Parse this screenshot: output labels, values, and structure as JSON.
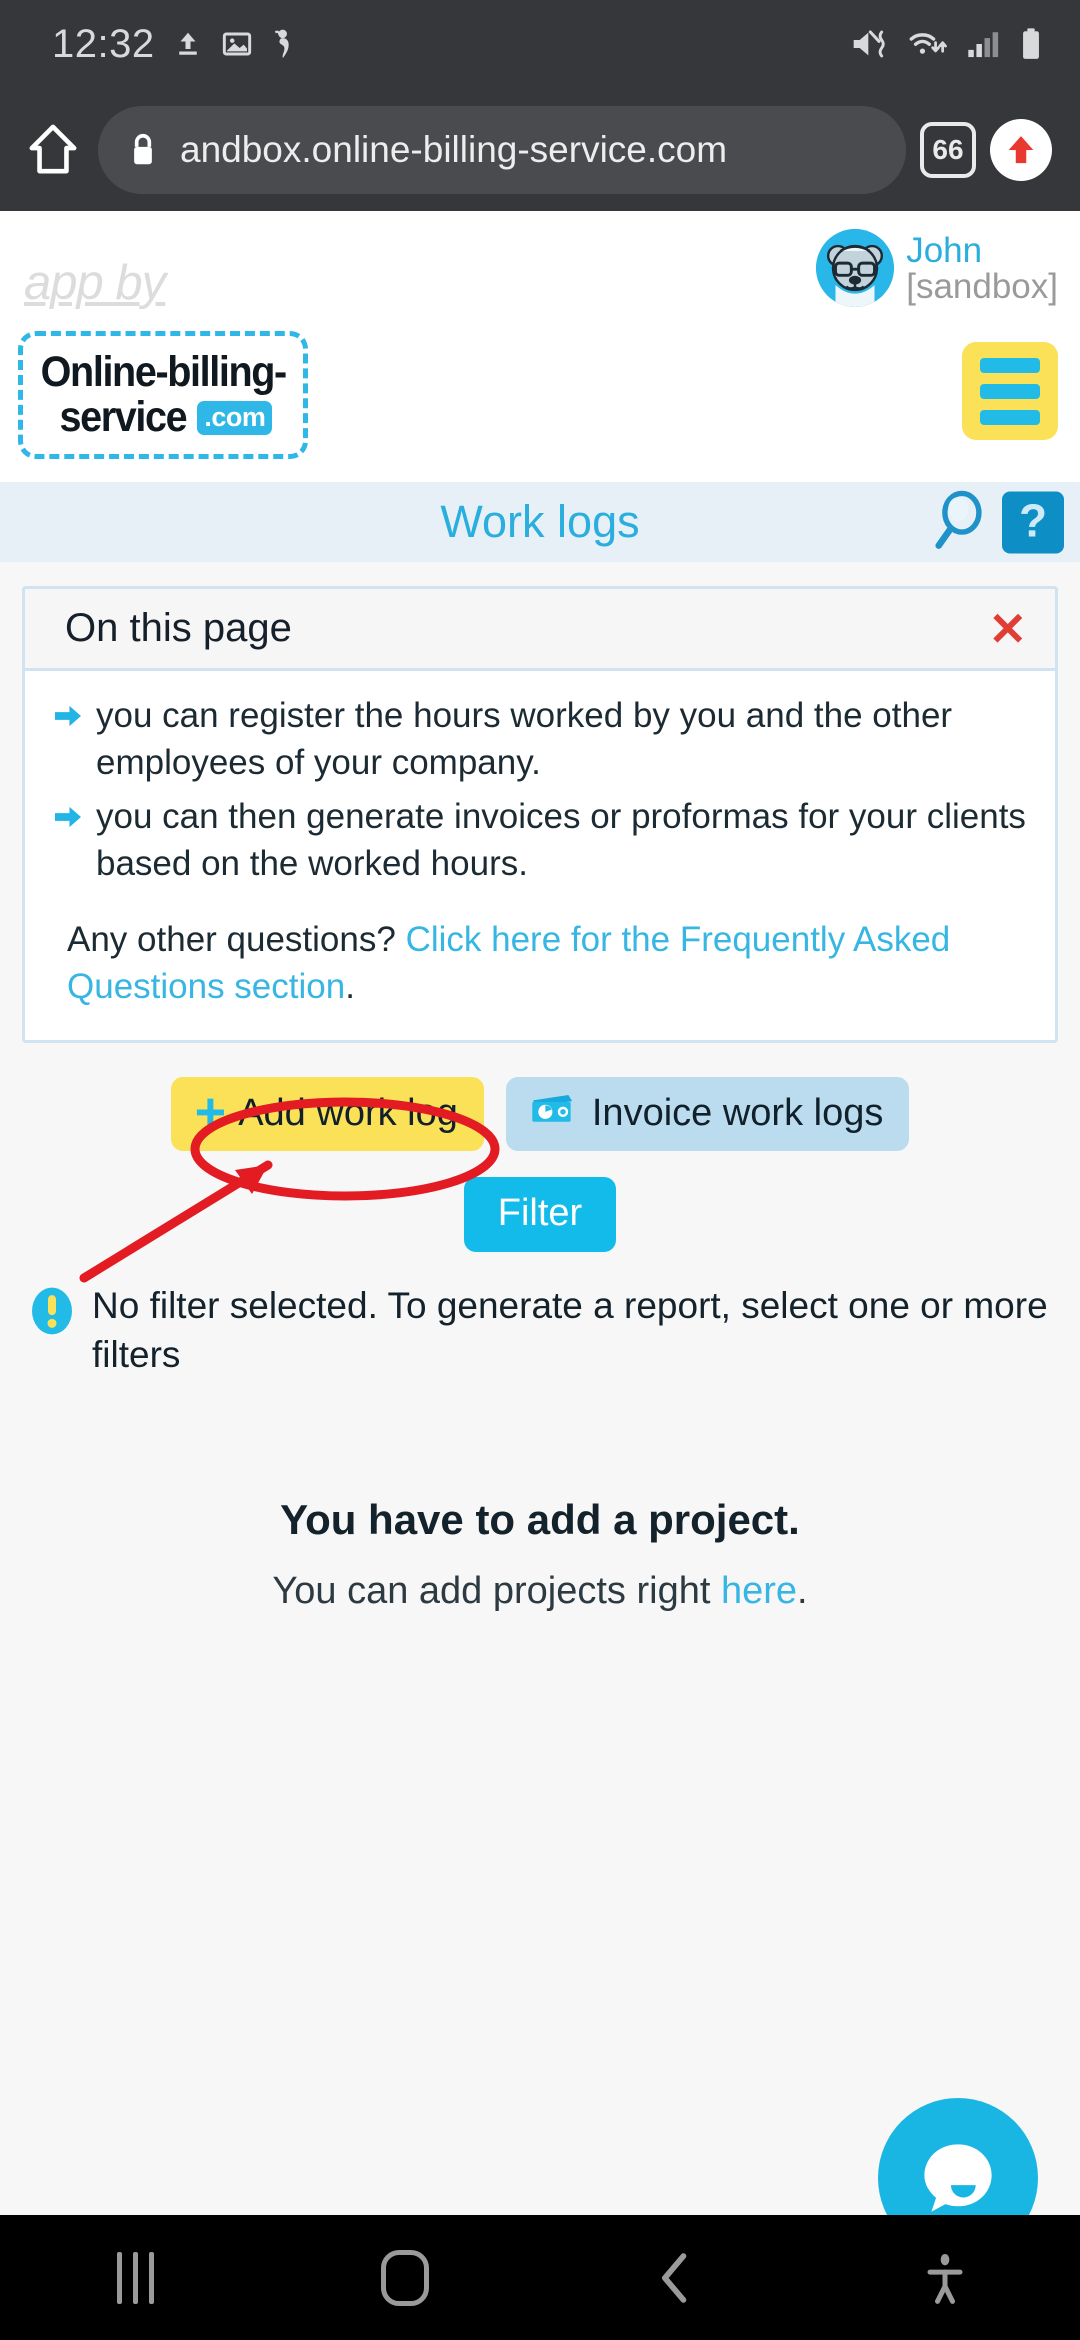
{
  "status_bar": {
    "clock": "12:32",
    "left_icons": [
      "upload-icon",
      "image-icon",
      "scuba-diver-icon"
    ],
    "right_icons": [
      "mute-vibrate-icon",
      "wifi-icon",
      "signal-icon",
      "battery-icon"
    ]
  },
  "browser": {
    "home_icon": "home-icon",
    "lock_icon": "lock-icon",
    "url": "andbox.online-billing-service.com",
    "tab_count": "66",
    "update_icon": "update-arrow-icon"
  },
  "site_header": {
    "app_by": "app by",
    "logo": {
      "line1": "Online-billing-",
      "line2": "service",
      "badge": ".com"
    },
    "user": {
      "name": "John",
      "environment": "[sandbox]"
    },
    "menu_icon": "hamburger-menu-icon"
  },
  "title_bar": {
    "title": "Work logs",
    "search_icon": "search-icon",
    "help_label": "?"
  },
  "info_panel": {
    "heading": "On this page",
    "close_label": "✕",
    "bullets": [
      "you can register the hours worked by you and the other employees of your company.",
      "you can then generate invoices or proformas for your clients based on the worked hours."
    ],
    "faq_prefix": "Any other questions? ",
    "faq_link": "Click here for the Frequently Asked Questions section",
    "faq_suffix": "."
  },
  "actions": {
    "add_work_log": "Add work log",
    "add_icon": "plus-icon",
    "invoice_work_logs": "Invoice work logs",
    "invoice_icon": "banknote-icon",
    "filter": "Filter"
  },
  "notice": {
    "icon": "warning-exclamation-icon",
    "text": "No filter selected. To generate a report, select one or more filters"
  },
  "empty_state": {
    "title": "You have to add a project.",
    "sub_prefix": "You can add projects right ",
    "sub_link": "here",
    "sub_suffix": "."
  },
  "chat": {
    "icon": "chat-bubble-icon"
  },
  "nav_bar": {
    "recents": "recents-icon",
    "home": "home-circle-icon",
    "back": "back-chevron-icon",
    "accessibility": "accessibility-icon"
  },
  "annotations": {
    "highlight_color": "#e31b23",
    "ellipse_target": "add-work-log-button",
    "arrow": "pointer-arrow"
  },
  "colors": {
    "accent_cyan": "#29b6e8",
    "yellow": "#fbe158",
    "light_blue": "#bbdcee",
    "panel_border": "#cfe3f0",
    "title_bar_bg": "#e8f0f7"
  }
}
